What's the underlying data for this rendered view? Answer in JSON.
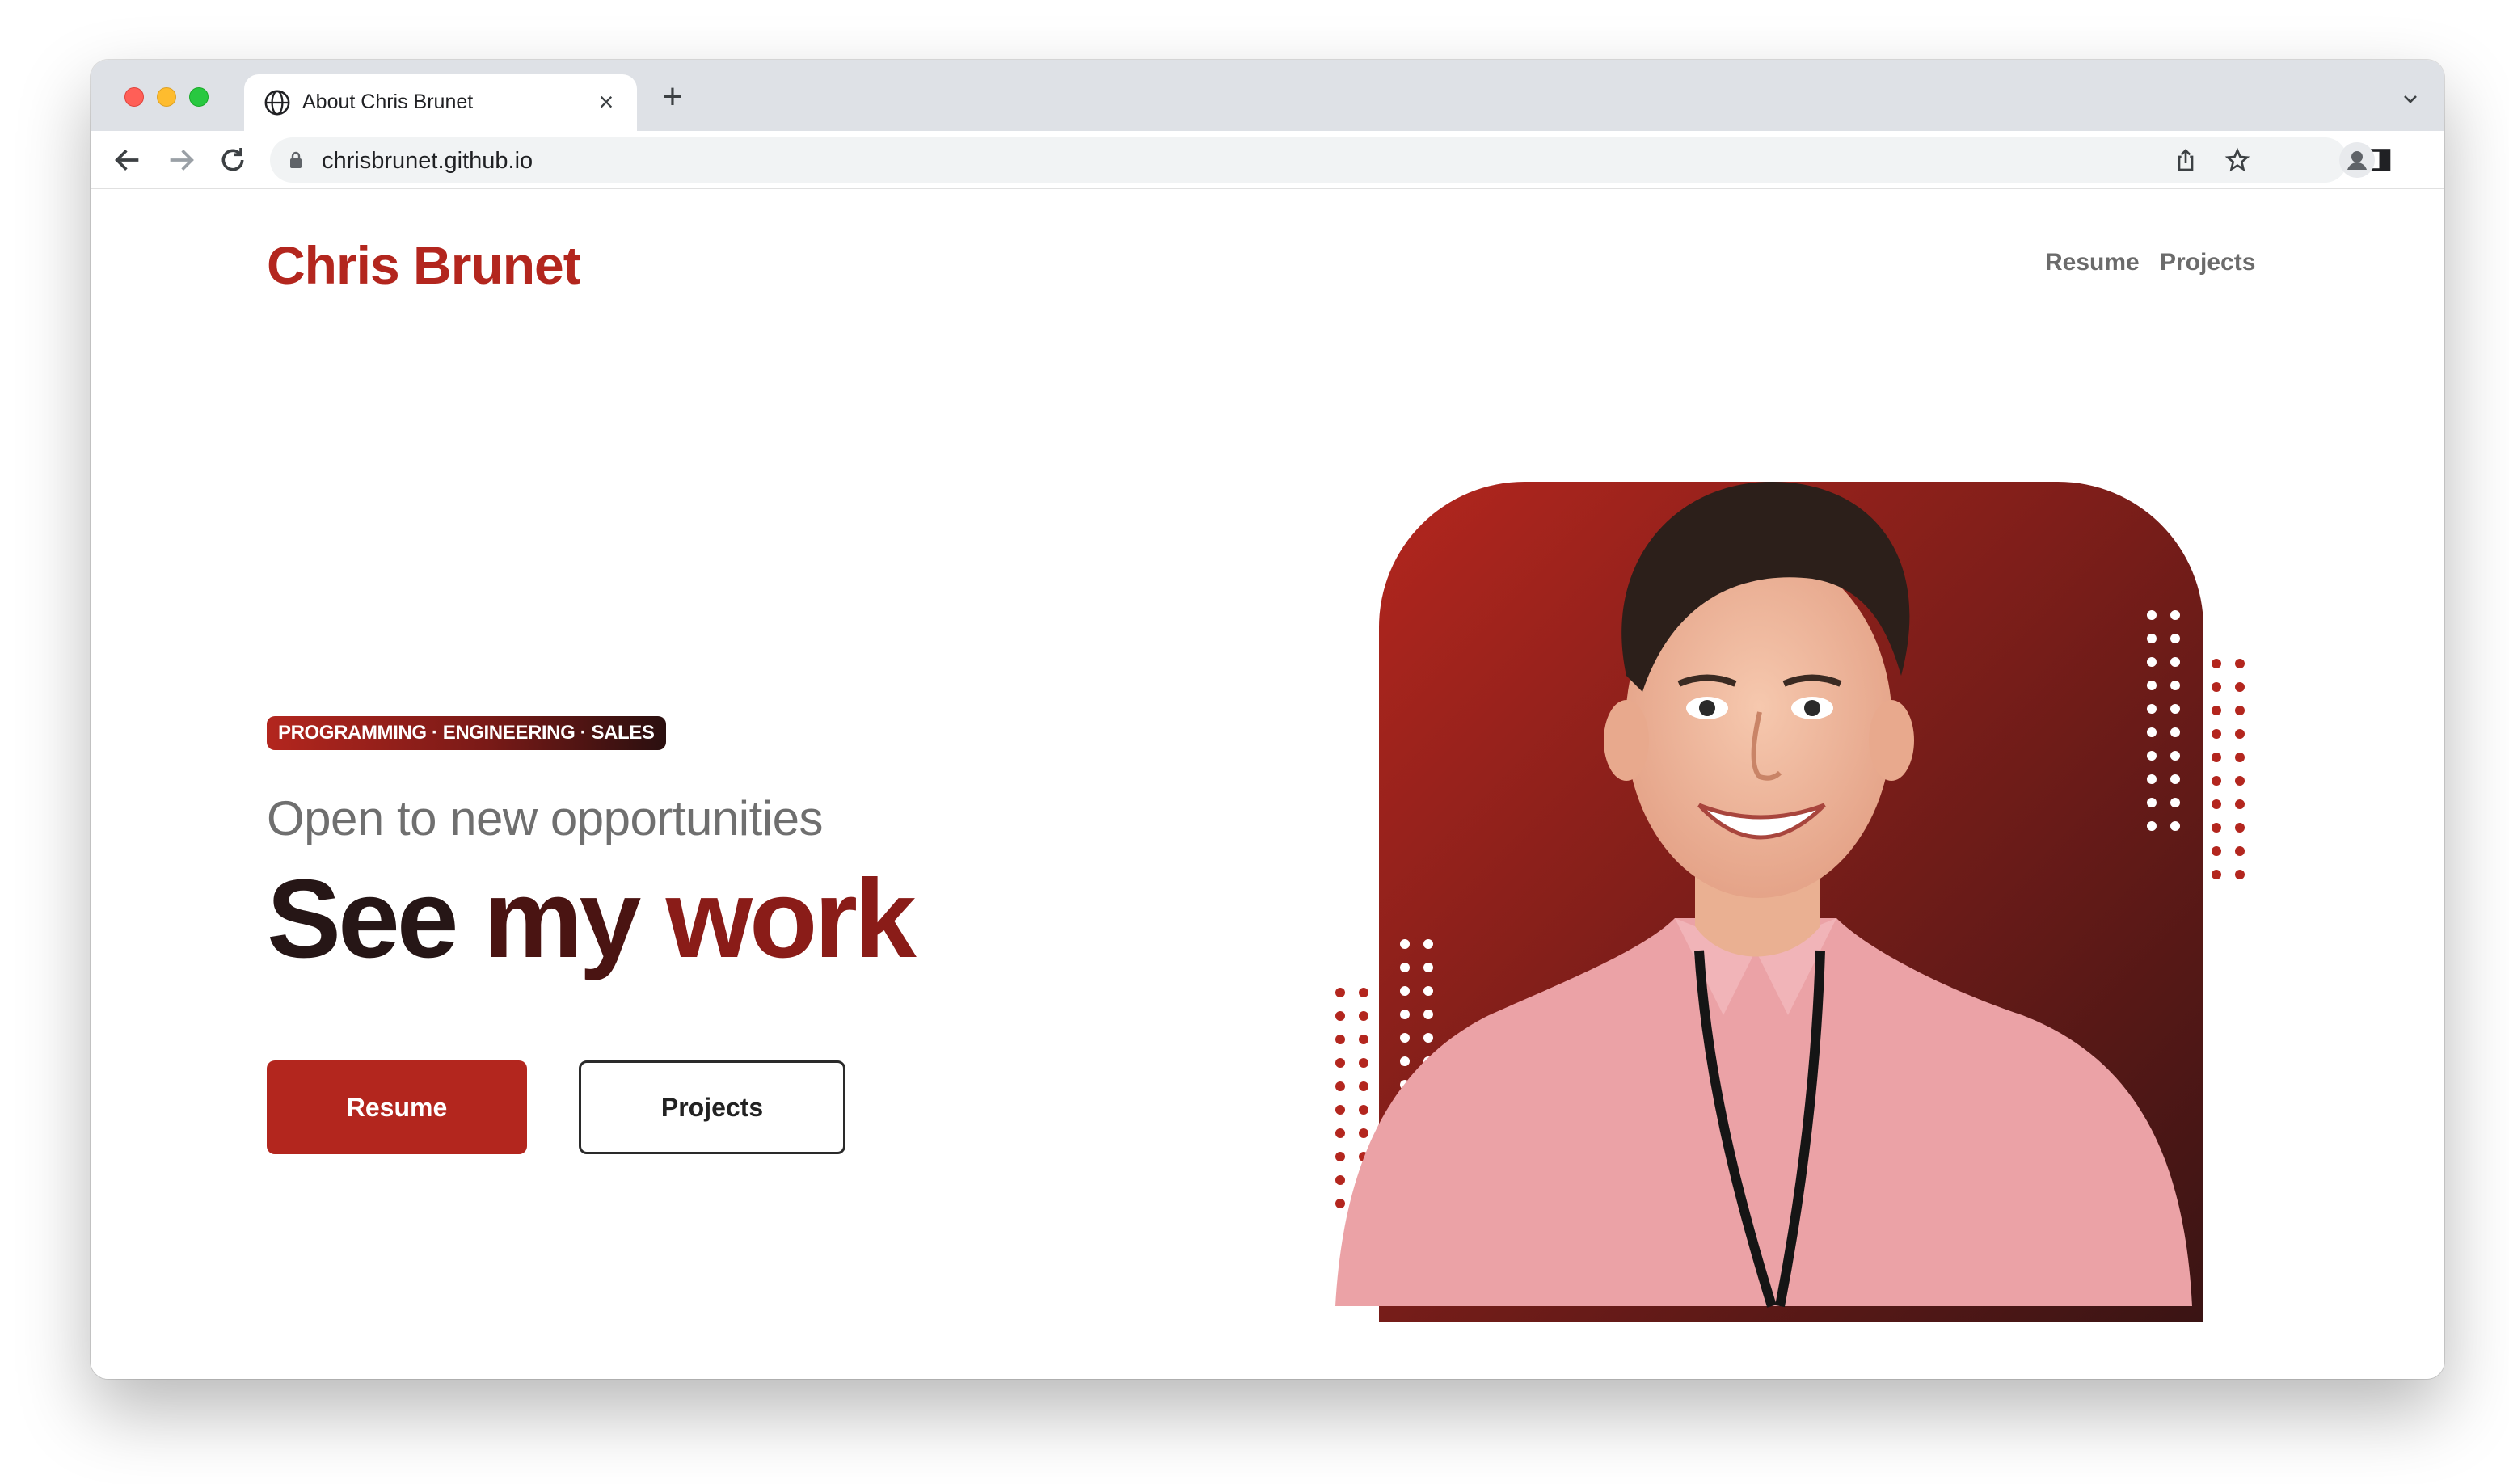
{
  "browser": {
    "tab_title": "About Chris Brunet",
    "url": "chrisbrunet.github.io",
    "icons": [
      "globe-icon",
      "close-icon",
      "plus-icon",
      "chevron-down-icon",
      "back-arrow-icon",
      "forward-arrow-icon",
      "reload-icon",
      "lock-icon",
      "share-icon",
      "star-icon",
      "sidebar-icon",
      "profile-icon",
      "kebab-menu-icon"
    ]
  },
  "site": {
    "brand": "Chris Brunet",
    "nav": {
      "resume": "Resume",
      "projects": "Projects"
    },
    "hero": {
      "tags": "PROGRAMMING · ENGINEERING · SALES",
      "subheading": "Open to new opportunities",
      "headline_words": [
        "See",
        "my",
        "work"
      ],
      "primary_button": "Resume",
      "secondary_button": "Projects"
    }
  },
  "colors": {
    "brand_red": "#b3261e",
    "dark_text": "#261616",
    "muted_text": "#6f6f6f"
  }
}
